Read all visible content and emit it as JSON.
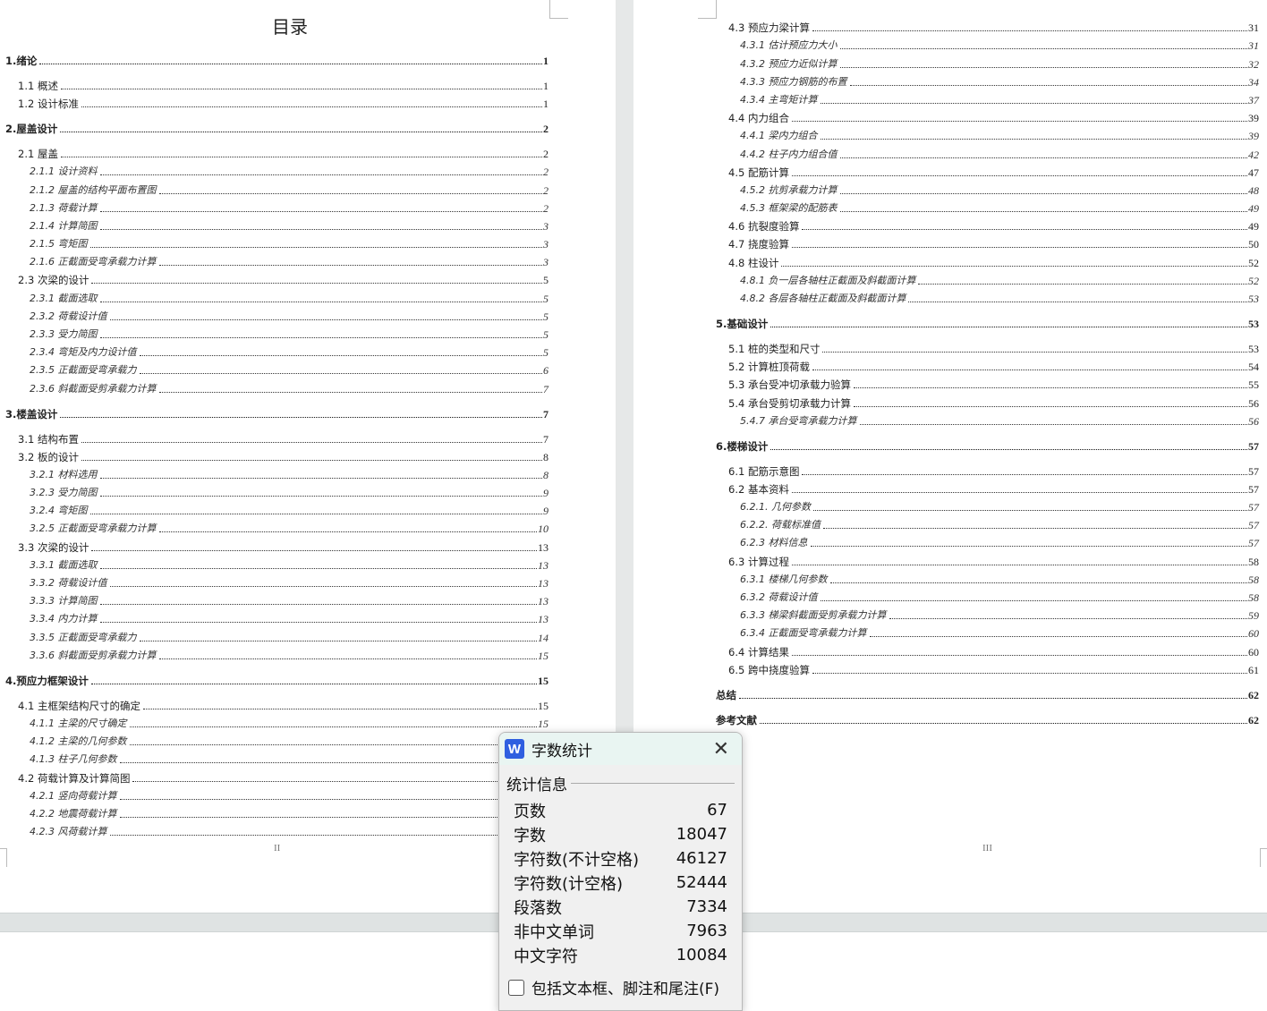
{
  "left_page": {
    "title": "目录",
    "page_number": "II",
    "entries": [
      {
        "level": 1,
        "label": "1.绪论",
        "page": "1"
      },
      {
        "level": 2,
        "label": "1.1 概述",
        "page": "1"
      },
      {
        "level": 2,
        "label": "1.2 设计标准",
        "page": "1"
      },
      {
        "level": 1,
        "label": "2.屋盖设计",
        "page": "2"
      },
      {
        "level": 2,
        "label": "2.1 屋盖",
        "page": "2"
      },
      {
        "level": 3,
        "label": "2.1.1 设计资料",
        "page": "2"
      },
      {
        "level": 3,
        "label": "2.1.2 屋盖的结构平面布置图",
        "page": "2"
      },
      {
        "level": 3,
        "label": "2.1.3 荷载计算",
        "page": "2"
      },
      {
        "level": 3,
        "label": "2.1.4 计算简图",
        "page": "3"
      },
      {
        "level": 3,
        "label": "2.1.5 弯矩图",
        "page": "3"
      },
      {
        "level": 3,
        "label": "2.1.6 正截面受弯承载力计算",
        "page": "3"
      },
      {
        "level": 2,
        "label": "2.3 次梁的设计",
        "page": "5"
      },
      {
        "level": 3,
        "label": "2.3.1 截面选取",
        "page": "5"
      },
      {
        "level": 3,
        "label": "2.3.2 荷载设计值",
        "page": "5"
      },
      {
        "level": 3,
        "label": "2.3.3 受力简图",
        "page": "5"
      },
      {
        "level": 3,
        "label": "2.3.4 弯矩及内力设计值",
        "page": "5"
      },
      {
        "level": 3,
        "label": "2.3.5 正截面受弯承载力",
        "page": "6"
      },
      {
        "level": 3,
        "label": "2.3.6 斜截面受剪承载力计算",
        "page": "7"
      },
      {
        "level": 1,
        "label": "3.楼盖设计",
        "page": "7"
      },
      {
        "level": 2,
        "label": "3.1 结构布置",
        "page": "7"
      },
      {
        "level": 2,
        "label": "3.2 板的设计",
        "page": "8"
      },
      {
        "level": 3,
        "label": "3.2.1 材料选用",
        "page": "8"
      },
      {
        "level": 3,
        "label": "3.2.3 受力简图",
        "page": "9"
      },
      {
        "level": 3,
        "label": "3.2.4 弯矩图",
        "page": "9"
      },
      {
        "level": 3,
        "label": "3.2.5 正截面受弯承载力计算",
        "page": "10"
      },
      {
        "level": 2,
        "label": "3.3 次梁的设计",
        "page": "13"
      },
      {
        "level": 3,
        "label": "3.3.1 截面选取",
        "page": "13"
      },
      {
        "level": 3,
        "label": "3.3.2 荷载设计值",
        "page": "13"
      },
      {
        "level": 3,
        "label": "3.3.3 计算简图",
        "page": "13"
      },
      {
        "level": 3,
        "label": "3.3.4 内力计算",
        "page": "13"
      },
      {
        "level": 3,
        "label": "3.3.5 正截面受弯承载力",
        "page": "14"
      },
      {
        "level": 3,
        "label": "3.3.6 斜截面受剪承载力计算",
        "page": "15"
      },
      {
        "level": 1,
        "label": "4.预应力框架设计",
        "page": "15"
      },
      {
        "level": 2,
        "label": "4.1 主框架结构尺寸的确定",
        "page": "15"
      },
      {
        "level": 3,
        "label": "4.1.1 主梁的尺寸确定",
        "page": "15"
      },
      {
        "level": 3,
        "label": "4.1.2 主梁的几何参数",
        "page": ""
      },
      {
        "level": 3,
        "label": "4.1.3 柱子几何参数",
        "page": ""
      },
      {
        "level": 2,
        "label": "4.2 荷载计算及计算简图",
        "page": ""
      },
      {
        "level": 3,
        "label": "4.2.1 竖向荷载计算",
        "page": ""
      },
      {
        "level": 3,
        "label": "4.2.2 地震荷载计算",
        "page": ""
      },
      {
        "level": 3,
        "label": "4.2.3 风荷载计算",
        "page": ""
      }
    ]
  },
  "right_page": {
    "page_number": "III",
    "entries": [
      {
        "level": 2,
        "label": "4.3 预应力梁计算",
        "page": "31"
      },
      {
        "level": 3,
        "label": "4.3.1 估计预应力大小",
        "page": "31"
      },
      {
        "level": 3,
        "label": "4.3.2 预应力近似计算",
        "page": "32"
      },
      {
        "level": 3,
        "label": "4.3.3 预应力钢筋的布置",
        "page": "34"
      },
      {
        "level": 3,
        "label": "4.3.4 主弯矩计算",
        "page": "37"
      },
      {
        "level": 2,
        "label": "4.4 内力组合",
        "page": "39"
      },
      {
        "level": 3,
        "label": "4.4.1 梁内力组合",
        "page": "39"
      },
      {
        "level": 3,
        "label": "4.4.2 柱子内力组合值",
        "page": "42"
      },
      {
        "level": 2,
        "label": "4.5 配筋计算",
        "page": "47"
      },
      {
        "level": 3,
        "label": "4.5.2 抗剪承载力计算",
        "page": "48"
      },
      {
        "level": 3,
        "label": "4.5.3 框架梁的配筋表",
        "page": "49"
      },
      {
        "level": 2,
        "label": "4.6 抗裂度验算",
        "page": "49"
      },
      {
        "level": 2,
        "label": "4.7 挠度验算",
        "page": "50"
      },
      {
        "level": 2,
        "label": "4.8 柱设计",
        "page": "52"
      },
      {
        "level": 3,
        "label": "4.8.1 负一层各轴柱正截面及斜截面计算",
        "page": "52"
      },
      {
        "level": 3,
        "label": "4.8.2 各层各轴柱正截面及斜截面计算",
        "page": "53"
      },
      {
        "level": 1,
        "label": "5.基础设计",
        "page": "53"
      },
      {
        "level": 2,
        "label": "5.1 桩的类型和尺寸",
        "page": "53"
      },
      {
        "level": 2,
        "label": "5.2 计算桩顶荷载",
        "page": "54"
      },
      {
        "level": 2,
        "label": "5.3 承台受冲切承载力验算",
        "page": "55"
      },
      {
        "level": 2,
        "label": "5.4 承台受剪切承载力计算",
        "page": "56"
      },
      {
        "level": 3,
        "label": "5.4.7 承台受弯承载力计算",
        "page": "56"
      },
      {
        "level": 1,
        "label": "6.楼梯设计",
        "page": "57"
      },
      {
        "level": 2,
        "label": "6.1 配筋示意图",
        "page": "57"
      },
      {
        "level": 2,
        "label": "6.2 基本资料",
        "page": "57"
      },
      {
        "level": 3,
        "label": "6.2.1.   几何参数",
        "page": "57"
      },
      {
        "level": 3,
        "label": "6.2.2.   荷载标准值",
        "page": "57"
      },
      {
        "level": 3,
        "label": "6.2.3  材料信息",
        "page": "57"
      },
      {
        "level": 2,
        "label": "6.3 计算过程",
        "page": "58"
      },
      {
        "level": 3,
        "label": "6.3.1  楼梯几何参数",
        "page": "58"
      },
      {
        "level": 3,
        "label": "6.3.2  荷载设计值",
        "page": "58"
      },
      {
        "level": 3,
        "label": "6.3.3  梯梁斜截面受剪承载力计算",
        "page": "59"
      },
      {
        "level": 3,
        "label": "6.3.4  正截面受弯承载力计算",
        "page": "60"
      },
      {
        "level": 2,
        "label": "6.4 计算结果",
        "page": "60"
      },
      {
        "level": 2,
        "label": "6.5 跨中挠度验算",
        "page": "61"
      },
      {
        "level": 1,
        "label": "总结",
        "page": "62"
      },
      {
        "level": 1,
        "label": "参考文献",
        "page": "62"
      }
    ]
  },
  "dialog": {
    "app_icon": "W",
    "title": "字数统计",
    "close_icon": "close-icon",
    "group_label": "统计信息",
    "stats": [
      {
        "label": "页数",
        "value": "67"
      },
      {
        "label": "字数",
        "value": "18047"
      },
      {
        "label": "字符数(不计空格)",
        "value": "46127"
      },
      {
        "label": "字符数(计空格)",
        "value": "52444"
      },
      {
        "label": "段落数",
        "value": "7334"
      },
      {
        "label": "非中文单词",
        "value": "7963"
      },
      {
        "label": "中文字符",
        "value": "10084"
      }
    ],
    "checkbox_label": "包括文本框、脚注和尾注(F)",
    "checkbox_checked": false,
    "accent_color": "#2f5fe0"
  }
}
